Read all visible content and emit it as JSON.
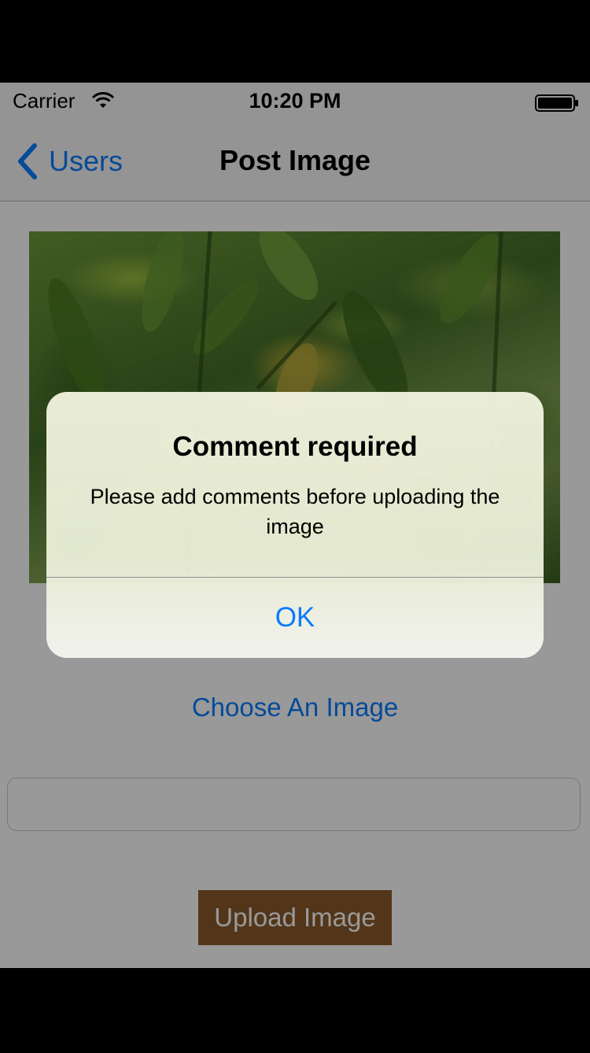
{
  "status_bar": {
    "carrier": "Carrier",
    "time": "10:20 PM",
    "wifi_icon": "wifi-icon",
    "battery_icon": "battery-icon"
  },
  "nav_bar": {
    "back_label": "Users",
    "back_icon": "chevron-left-icon",
    "title": "Post Image"
  },
  "content": {
    "choose_image_label": "Choose An Image",
    "comment_field_value": "",
    "upload_button_label": "Upload Image"
  },
  "alert": {
    "title": "Comment required",
    "message": "Please add comments before uploading the image",
    "ok_label": "OK"
  },
  "colors": {
    "accent": "#0a7cff",
    "upload_button_bg": "#8b5a2b",
    "nav_bar_bg": "#f7f7f7"
  }
}
